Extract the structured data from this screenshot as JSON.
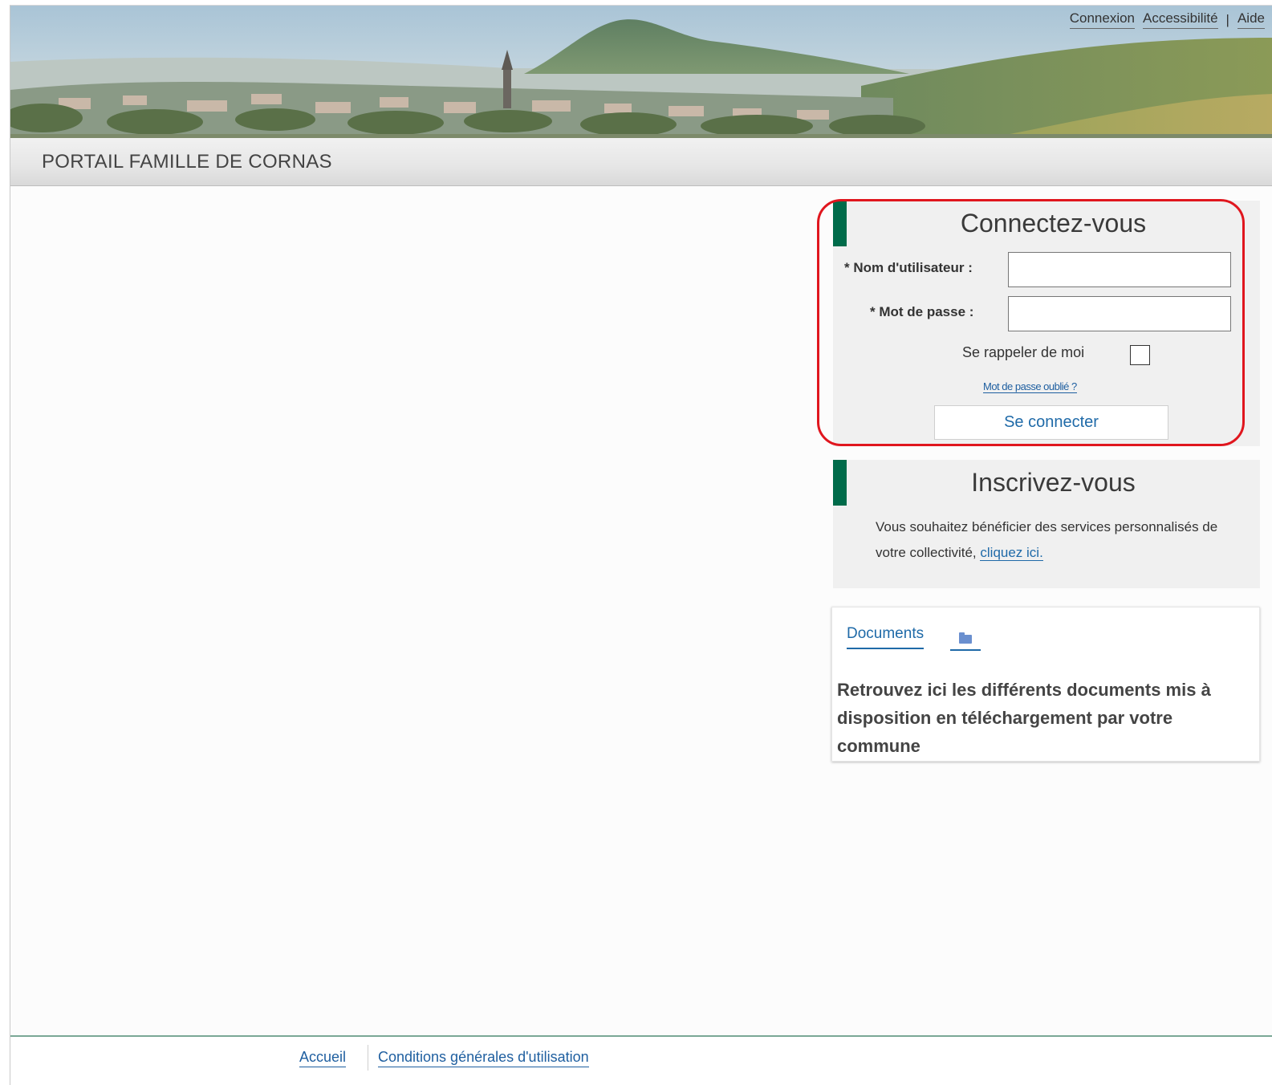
{
  "topnav": {
    "login": "Connexion",
    "accessibility": "Accessibilité",
    "separator": "|",
    "help": "Aide"
  },
  "site": {
    "title": "PORTAIL FAMILLE DE CORNAS"
  },
  "login_panel": {
    "heading": "Connectez-vous",
    "username_label": "* Nom d'utilisateur :",
    "username_value": "",
    "password_label": "* Mot de passe :",
    "password_value": "",
    "remember_label": "Se rappeler de moi",
    "remember_checked": false,
    "forgot_link": "Mot de passe oublié ?",
    "submit_label": "Se connecter"
  },
  "signup_panel": {
    "heading": "Inscrivez-vous",
    "message": "Vous souhaitez bénéficier des services personnalisés de votre collectivité, ",
    "link": "cliquez ici."
  },
  "documents_panel": {
    "tab_label": "Documents",
    "tab_icon": "folder-icon",
    "description": "Retrouvez ici les différents documents mis à disposition en téléchargement par votre commune"
  },
  "footer": {
    "home": "Accueil",
    "terms": "Conditions générales d'utilisation"
  },
  "colors": {
    "accent_green": "#006b4a",
    "link_blue": "#1f6aa8",
    "highlight_red": "#e0161e"
  }
}
